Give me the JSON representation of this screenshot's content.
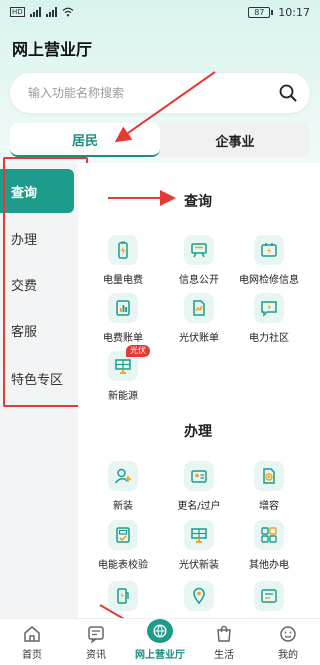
{
  "status_bar": {
    "time": "10:17",
    "battery": "87",
    "signal_tag": "HD"
  },
  "header": {
    "title": "网上营业厅"
  },
  "search": {
    "placeholder": "输入功能名称搜索"
  },
  "segments": [
    {
      "label": "居民",
      "active": true
    },
    {
      "label": "企事业",
      "active": false
    }
  ],
  "sidebar": {
    "items": [
      {
        "label": "查询",
        "active": true
      },
      {
        "label": "办理"
      },
      {
        "label": "交费"
      },
      {
        "label": "客服"
      },
      {
        "label": "特色专区"
      }
    ]
  },
  "sections": [
    {
      "title": "查询",
      "items": [
        {
          "label": "电量电费",
          "icon": "battery-icon"
        },
        {
          "label": "信息公开",
          "icon": "billboard-icon"
        },
        {
          "label": "电网检修信息",
          "icon": "repair-icon"
        },
        {
          "label": "电费账单",
          "icon": "bar-chart-icon"
        },
        {
          "label": "光伏账单",
          "icon": "solar-bill-icon"
        },
        {
          "label": "电力社区",
          "icon": "chat-bolt-icon"
        },
        {
          "label": "新能源",
          "icon": "solar-panel-icon",
          "badge": "光伏"
        }
      ]
    },
    {
      "title": "办理",
      "items": [
        {
          "label": "新装",
          "icon": "user-add-icon"
        },
        {
          "label": "更名/过户",
          "icon": "id-card-icon"
        },
        {
          "label": "增容",
          "icon": "add-document-icon"
        },
        {
          "label": "电能表校验",
          "icon": "meter-icon"
        },
        {
          "label": "光伏新装",
          "icon": "solar-panel-icon"
        },
        {
          "label": "其他办电",
          "icon": "grid-apps-icon"
        }
      ]
    }
  ],
  "tabbar": {
    "items": [
      {
        "label": "首页",
        "icon": "home-icon"
      },
      {
        "label": "资讯",
        "icon": "news-icon"
      },
      {
        "label": "网上营业厅",
        "icon": "globe-icon",
        "active": true
      },
      {
        "label": "生活",
        "icon": "shopping-bag-icon"
      },
      {
        "label": "我的",
        "icon": "smile-face-icon"
      }
    ]
  },
  "colors": {
    "accent": "#1e9c8b",
    "annotation": "#e53935"
  }
}
